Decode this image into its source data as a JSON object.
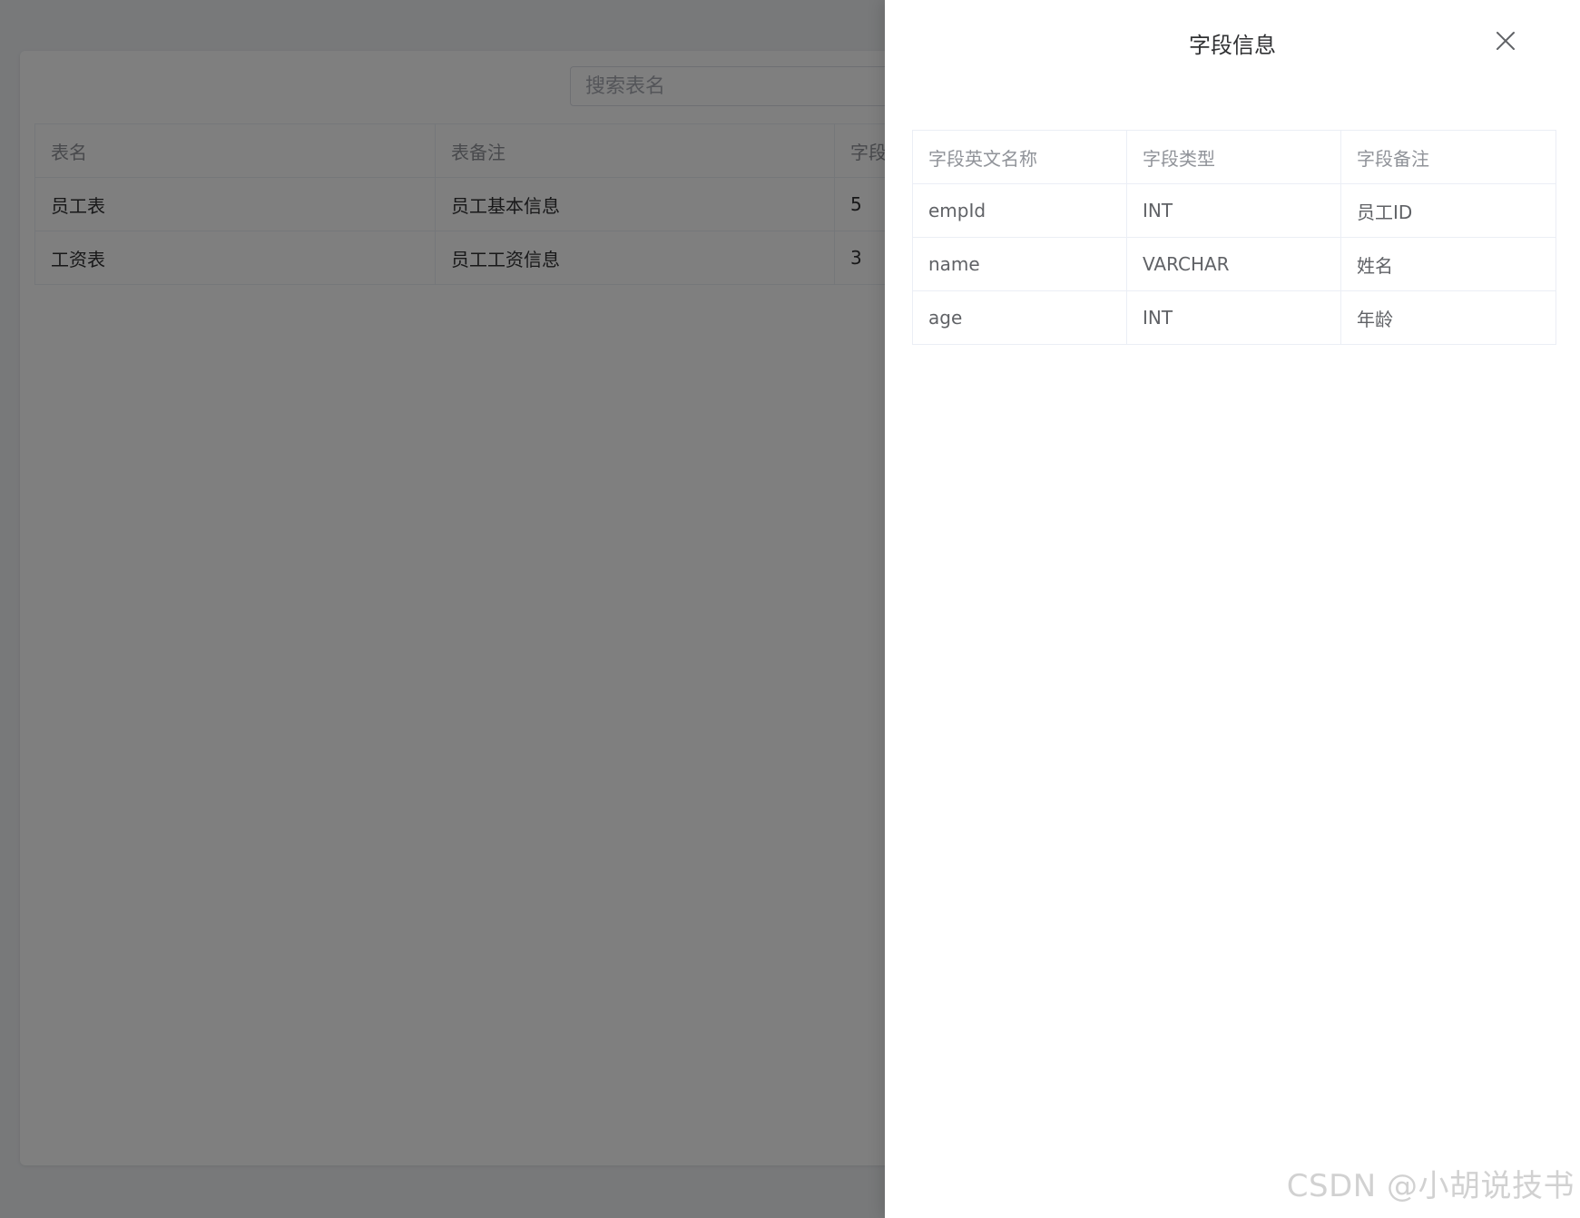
{
  "background": {
    "search": {
      "placeholder": "搜索表名"
    },
    "table": {
      "headers": [
        "表名",
        "表备注",
        "字段"
      ],
      "rows": [
        [
          "员工表",
          "员工基本信息",
          "5"
        ],
        [
          "工资表",
          "员工工资信息",
          "3"
        ]
      ]
    }
  },
  "drawer": {
    "title": "字段信息",
    "close_icon": "close-icon",
    "table": {
      "headers": [
        "字段英文名称",
        "字段类型",
        "字段备注"
      ],
      "rows": [
        [
          "empId",
          "INT",
          "员工ID"
        ],
        [
          "name",
          "VARCHAR",
          "姓名"
        ],
        [
          "age",
          "INT",
          "年龄"
        ]
      ]
    }
  },
  "watermark": "CSDN @小胡说技书",
  "colors": {
    "overlay": "#000000",
    "border": "#ebeef5",
    "header_text": "#909399",
    "cell_text": "#606266"
  }
}
